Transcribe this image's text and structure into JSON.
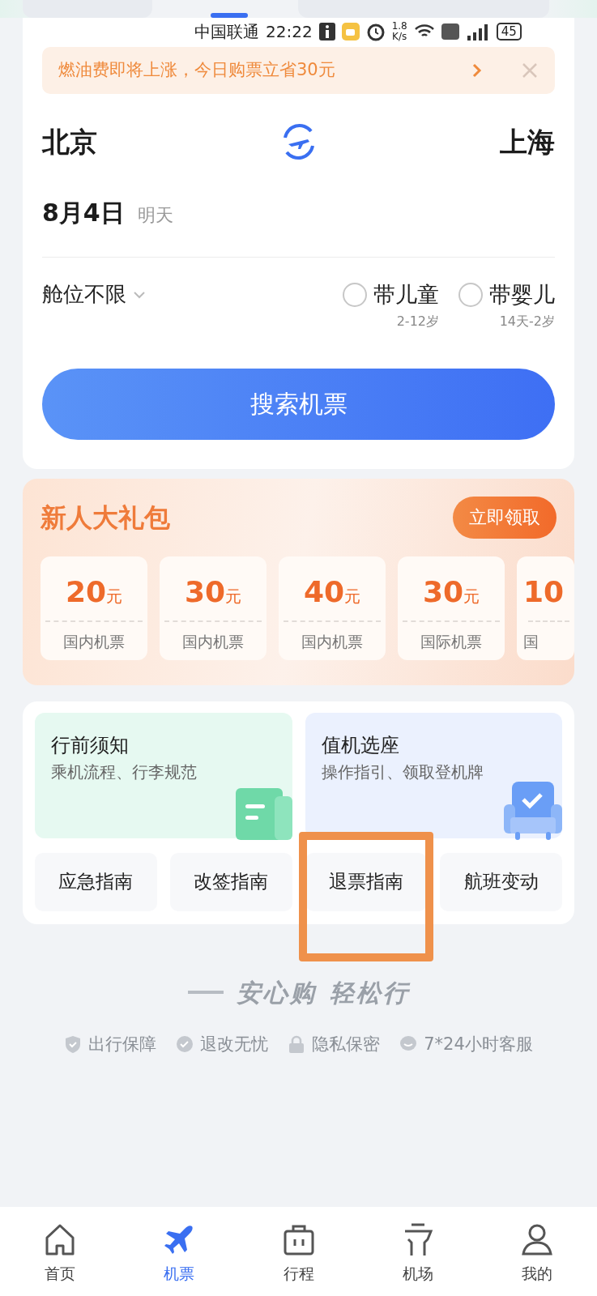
{
  "status_bar": {
    "carrier": "中国联通",
    "time": "22:22",
    "speed": "1.8",
    "speed_unit": "K/s",
    "battery": "45"
  },
  "notice": {
    "text": "燃油费即将上涨，今日购票立省30元"
  },
  "route": {
    "from": "北京",
    "to": "上海"
  },
  "date": {
    "date": "8月4日",
    "day": "明天"
  },
  "cabin": {
    "label": "舱位不限"
  },
  "passengers": [
    {
      "label": "带儿童",
      "age": "2-12岁",
      "checked": false
    },
    {
      "label": "带婴儿",
      "age": "14天-2岁",
      "checked": false
    }
  ],
  "search_button": "搜索机票",
  "promo": {
    "title": "新人大礼包",
    "claim_button": "立即领取",
    "coupons": [
      {
        "amount": "20",
        "unit": "元",
        "type": "国内机票"
      },
      {
        "amount": "30",
        "unit": "元",
        "type": "国内机票"
      },
      {
        "amount": "40",
        "unit": "元",
        "type": "国内机票"
      },
      {
        "amount": "30",
        "unit": "元",
        "type": "国际机票"
      },
      {
        "amount": "10",
        "type": "国"
      }
    ]
  },
  "guides": {
    "featured": [
      {
        "kind": "document",
        "title": "行前须知",
        "subtitle": "乘机流程、行李规范"
      },
      {
        "kind": "seat",
        "title": "值机选座",
        "subtitle": "操作指引、领取登机牌"
      }
    ],
    "links": [
      {
        "label": "应急指南",
        "highlighted": false
      },
      {
        "label": "改签指南",
        "highlighted": false
      },
      {
        "label": "退票指南",
        "highlighted": true
      },
      {
        "label": "航班变动",
        "highlighted": false
      }
    ]
  },
  "slogan": [
    "安心购",
    "轻松行"
  ],
  "guarantees": [
    {
      "kind": "shield",
      "label": "出行保障"
    },
    {
      "kind": "check",
      "label": "退改无忧"
    },
    {
      "kind": "lock",
      "label": "隐私保密"
    },
    {
      "kind": "chat",
      "label": "7*24小时客服"
    }
  ],
  "tabs": [
    {
      "kind": "home",
      "label": "首页",
      "selected": false
    },
    {
      "kind": "plane",
      "label": "机票",
      "selected": true
    },
    {
      "kind": "suitcase",
      "label": "行程",
      "selected": false
    },
    {
      "kind": "airport",
      "label": "机场",
      "selected": false
    },
    {
      "kind": "person",
      "label": "我的",
      "selected": false
    }
  ]
}
